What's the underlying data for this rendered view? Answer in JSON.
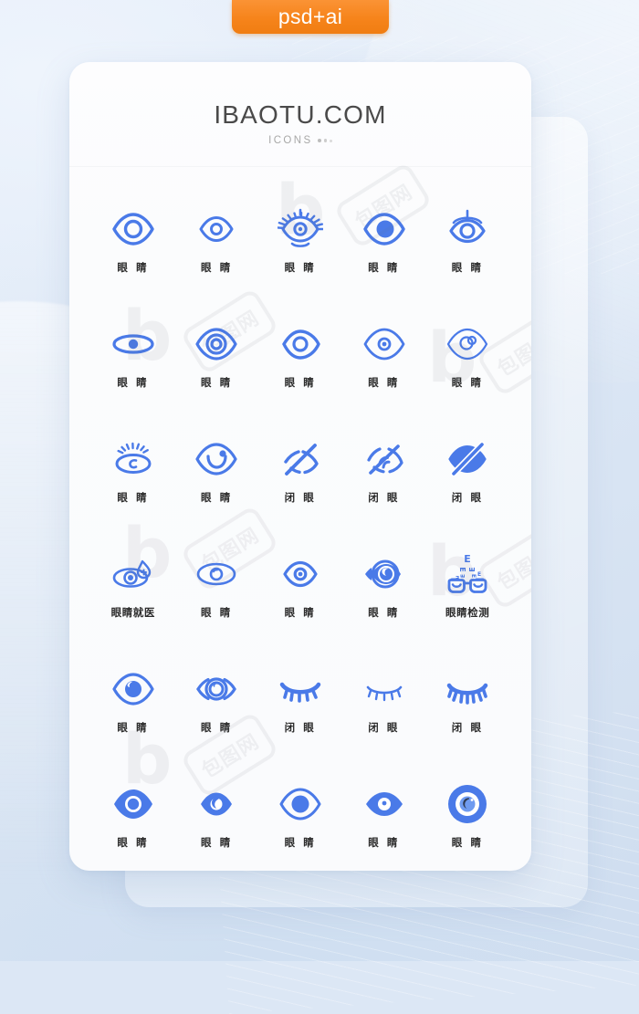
{
  "badge": {
    "label": "psd+ai",
    "color": "#f6841b"
  },
  "card": {
    "title": "IBAOTU.COM",
    "subtitle": "ICONS",
    "dots_count": 3
  },
  "theme": {
    "icon_blue": "#4a7ae8",
    "icon_blue_light": "#6f9bf0",
    "background": "#dce7f5",
    "card_background": "#fbfcfd",
    "label_color": "#2b2b2b",
    "title_color": "#4a4a4a"
  },
  "watermarks": [
    {
      "text": "包图网",
      "kind": "box"
    },
    {
      "text": "b",
      "kind": "logo"
    }
  ],
  "grid": {
    "columns": 5,
    "rows": 6,
    "icons": [
      {
        "name": "eye-double-ring",
        "label": "眼 睛",
        "shape": "eye-double-ring"
      },
      {
        "name": "eye-outline-circle",
        "label": "眼 睛",
        "shape": "eye-outline-circle"
      },
      {
        "name": "eye-lashes-dot",
        "label": "眼 睛",
        "shape": "eye-lashes-dot"
      },
      {
        "name": "eye-filled-iris",
        "label": "眼 睛",
        "shape": "eye-filled-iris"
      },
      {
        "name": "eye-brow-ring",
        "label": "眼 睛",
        "shape": "eye-brow-ring"
      },
      {
        "name": "eye-ellipse-dot",
        "label": "眼 睛",
        "shape": "eye-ellipse-dot"
      },
      {
        "name": "eye-triple-ring",
        "label": "眼 睛",
        "shape": "eye-triple-ring"
      },
      {
        "name": "eye-open-gap-ring",
        "label": "眼 睛",
        "shape": "eye-open-gap-ring"
      },
      {
        "name": "eye-thin-dot",
        "label": "眼 睛",
        "shape": "eye-thin-dot"
      },
      {
        "name": "eye-two-circles",
        "label": "眼 睛",
        "shape": "eye-two-circles"
      },
      {
        "name": "eye-rays-spiral",
        "label": "眼 睛",
        "shape": "eye-rays-spiral"
      },
      {
        "name": "eye-smile-iris",
        "label": "眼 睛",
        "shape": "eye-smile-iris"
      },
      {
        "name": "eye-slashed-open",
        "label": "闭 眼",
        "shape": "eye-slashed-open"
      },
      {
        "name": "eye-slashed-arcs",
        "label": "闭 眼",
        "shape": "eye-slashed-arcs"
      },
      {
        "name": "eye-slashed-solid",
        "label": "闭 眼",
        "shape": "eye-slashed-solid"
      },
      {
        "name": "eye-medical-drop",
        "label": "眼睛就医",
        "shape": "eye-medical-drop"
      },
      {
        "name": "eye-oval-ring",
        "label": "眼 睛",
        "shape": "eye-oval-ring"
      },
      {
        "name": "eye-outline-dot",
        "label": "眼 睛",
        "shape": "eye-outline-dot"
      },
      {
        "name": "eye-crescent-circle",
        "label": "眼 睛",
        "shape": "eye-crescent-circle"
      },
      {
        "name": "eye-chart-glasses",
        "label": "眼睛检测",
        "shape": "eye-chart-glasses"
      },
      {
        "name": "eye-solid-crescent",
        "label": "眼 睛",
        "shape": "eye-solid-crescent"
      },
      {
        "name": "eye-dashed-ring",
        "label": "眼 睛",
        "shape": "eye-dashed-ring"
      },
      {
        "name": "closed-eye-lashes-bold",
        "label": "闭 眼",
        "shape": "closed-eye-lashes-bold"
      },
      {
        "name": "closed-eye-lashes-thin",
        "label": "闭 眼",
        "shape": "closed-eye-lashes-thin"
      },
      {
        "name": "closed-eye-lashes-long",
        "label": "闭 眼",
        "shape": "closed-eye-lashes-long"
      },
      {
        "name": "eye-solid-ring",
        "label": "眼 睛",
        "shape": "eye-solid-ring"
      },
      {
        "name": "eye-solid-moon",
        "label": "眼 睛",
        "shape": "eye-solid-moon"
      },
      {
        "name": "eye-solid-highlight",
        "label": "眼 睛",
        "shape": "eye-solid-highlight"
      },
      {
        "name": "eye-solid-pupil-dot",
        "label": "眼 睛",
        "shape": "eye-solid-pupil-dot"
      },
      {
        "name": "eye-target-circle",
        "label": "眼 睛",
        "shape": "eye-target-circle"
      }
    ]
  }
}
